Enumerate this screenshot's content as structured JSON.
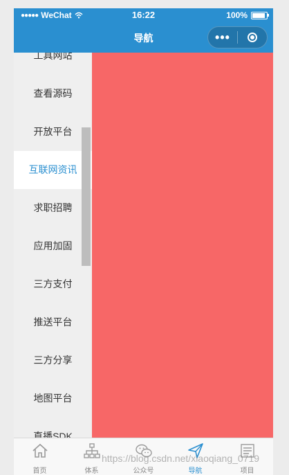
{
  "status_bar": {
    "signal": "●●●●●",
    "carrier": "WeChat",
    "time": "16:22",
    "battery": "100%"
  },
  "nav": {
    "title": "导航",
    "more_glyph": "•••"
  },
  "sidebar": {
    "items": [
      {
        "label": "工具网站"
      },
      {
        "label": "查看源码"
      },
      {
        "label": "开放平台"
      },
      {
        "label": "互联网资讯"
      },
      {
        "label": "求职招聘"
      },
      {
        "label": "应用加固"
      },
      {
        "label": "三方支付"
      },
      {
        "label": "推送平台"
      },
      {
        "label": "三方分享"
      },
      {
        "label": "地图平台"
      },
      {
        "label": "直播SDK"
      }
    ],
    "active_index": 3
  },
  "content": {
    "color": "#f76767"
  },
  "tabbar": {
    "tabs": [
      {
        "label": "首页",
        "icon": "home-icon"
      },
      {
        "label": "体系",
        "icon": "hierarchy-icon"
      },
      {
        "label": "公众号",
        "icon": "wechat-icon"
      },
      {
        "label": "导航",
        "icon": "navigation-arrow-icon"
      },
      {
        "label": "项目",
        "icon": "project-list-icon"
      }
    ],
    "active_index": 3
  },
  "watermark": "https://blog.csdn.net/xiaoqiang_0719",
  "colors": {
    "primary": "#2a8fd0",
    "content_red": "#f76767",
    "sidebar_bg": "#efefef"
  }
}
